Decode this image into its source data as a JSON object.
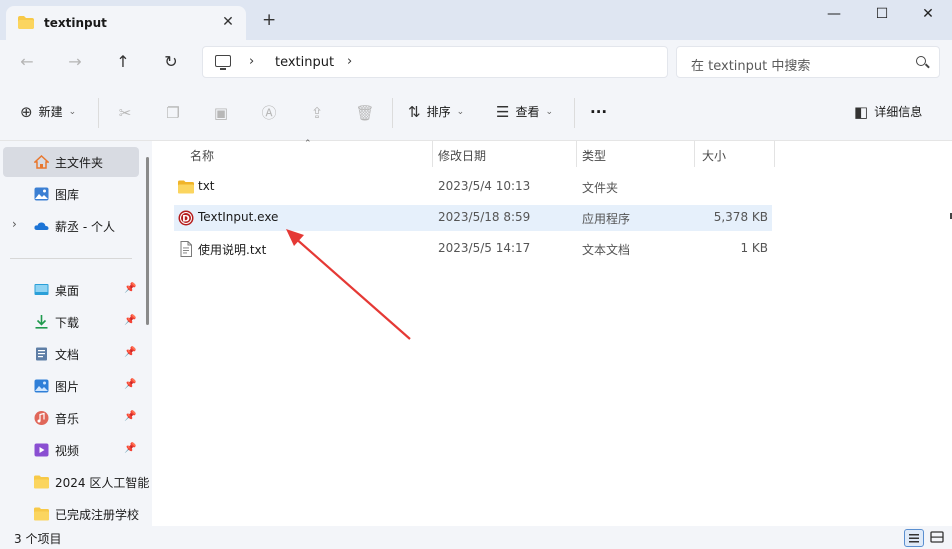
{
  "window": {
    "tab_title": "textinput",
    "new_tab_icon": "plus-icon",
    "controls": {
      "minimize": "—",
      "maximize": "☐",
      "close": "✕"
    }
  },
  "address": {
    "breadcrumb": [
      "textinput"
    ],
    "search_placeholder": "在 textinput 中搜索"
  },
  "toolbar": {
    "new_label": "新建",
    "sort_label": "排序",
    "view_label": "查看",
    "more_label": "···",
    "details_label": "详细信息"
  },
  "sidebar": {
    "items": [
      {
        "label": "主文件夹",
        "icon": "home-icon",
        "selected": true
      },
      {
        "label": "图库",
        "icon": "gallery-icon"
      },
      {
        "label": "薪丞 - 个人",
        "icon": "onedrive-cloud-icon",
        "expandable": true
      }
    ],
    "pinned": [
      {
        "label": "桌面",
        "icon": "desktop-icon"
      },
      {
        "label": "下载",
        "icon": "download-icon"
      },
      {
        "label": "文档",
        "icon": "document-icon"
      },
      {
        "label": "图片",
        "icon": "pictures-icon"
      },
      {
        "label": "音乐",
        "icon": "music-icon"
      },
      {
        "label": "视频",
        "icon": "video-icon"
      },
      {
        "label": "2024 区人工智能",
        "icon": "folder-icon"
      },
      {
        "label": "已完成注册学校",
        "icon": "folder-icon"
      }
    ]
  },
  "list": {
    "columns": [
      "名称",
      "修改日期",
      "类型",
      "大小"
    ],
    "rows": [
      {
        "name": "txt",
        "date": "2023/5/4 10:13",
        "type": "文件夹",
        "size": "",
        "icon": "folder-icon"
      },
      {
        "name": "TextInput.exe",
        "date": "2023/5/18 8:59",
        "type": "应用程序",
        "size": "5,378 KB",
        "icon": "app-exe-icon",
        "selected": true
      },
      {
        "name": "使用说明.txt",
        "date": "2023/5/5 14:17",
        "type": "文本文档",
        "size": "1 KB",
        "icon": "text-file-icon"
      }
    ]
  },
  "status": {
    "item_count": "3 个项目"
  },
  "colors": {
    "accent": "#0067c0",
    "arrow": "#e53935",
    "folder": "#f7c948",
    "selection": "#e6f0fb"
  }
}
